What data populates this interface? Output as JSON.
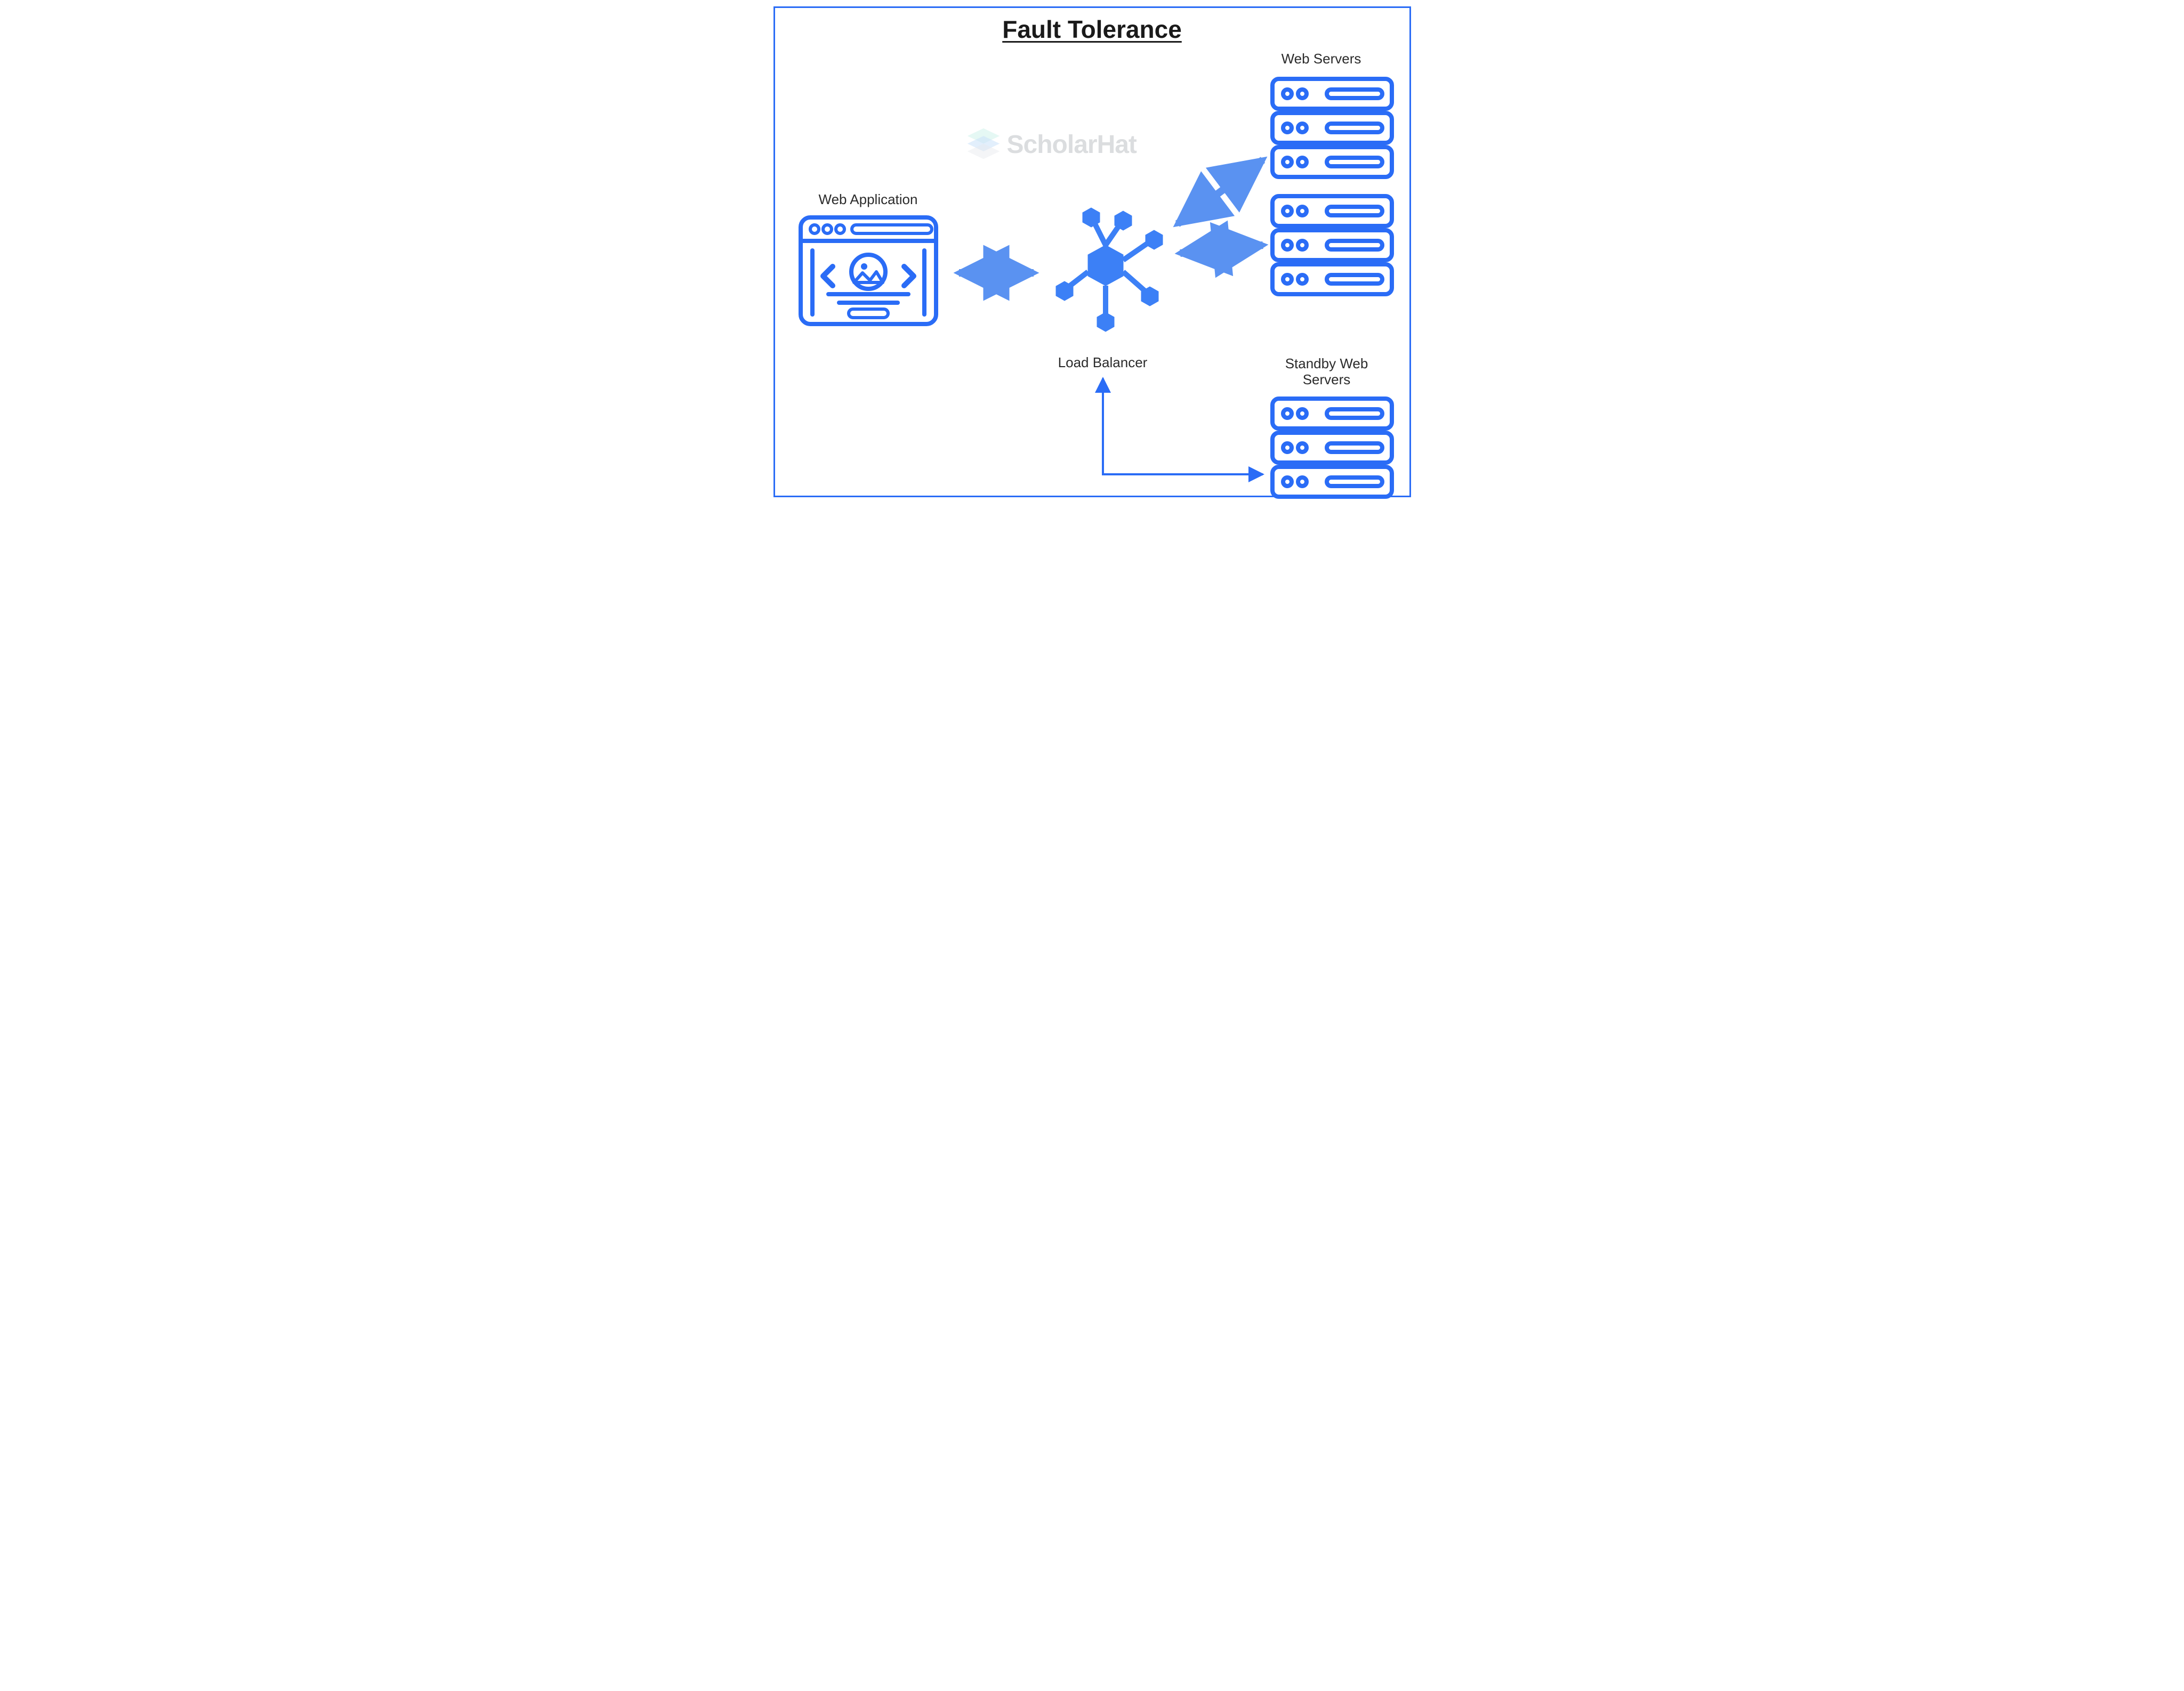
{
  "title": "Fault Tolerance",
  "watermark": "ScholarHat",
  "labels": {
    "web_application": "Web Application",
    "load_balancer": "Load Balancer",
    "web_servers": "Web Servers",
    "standby_line1": "Standby Web",
    "standby_line2": "Servers"
  },
  "colors": {
    "blue": "#2a6cf6",
    "blue_fill": "#3c80f6",
    "blue_soft": "#8fb7f9",
    "text": "#2b2b2b",
    "wm_mint": "#9fe3d5",
    "wm_blue": "#6aabf3",
    "wm_gray": "#b9beca"
  },
  "nodes": {
    "web_application": "web-app",
    "load_balancer": "load-balancer",
    "web_servers": "web-servers",
    "standby_web_servers": "standby-web-servers"
  },
  "connections": [
    {
      "from": "web-app",
      "to": "load-balancer",
      "bidirectional": true
    },
    {
      "from": "load-balancer",
      "to": "web-servers",
      "bidirectional": true,
      "count": 2
    },
    {
      "from": "load-balancer",
      "to": "standby-web-servers",
      "bidirectional": true,
      "style": "elbow"
    }
  ]
}
